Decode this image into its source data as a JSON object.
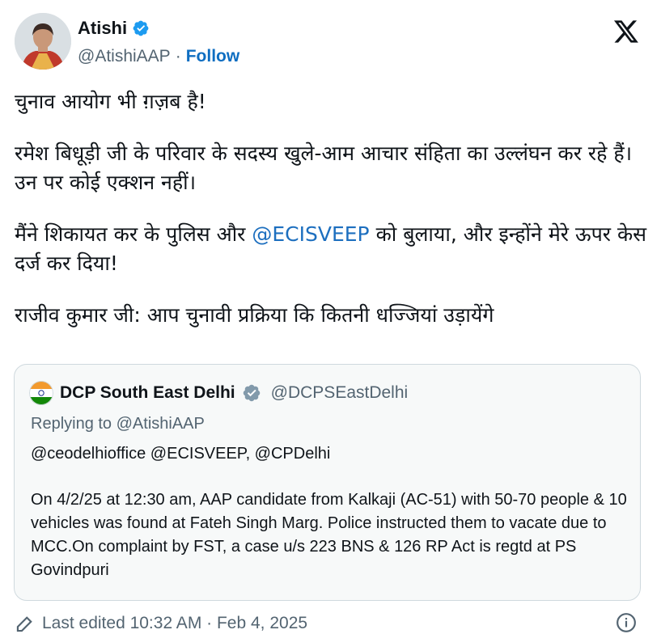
{
  "author": {
    "name": "Atishi",
    "handle": "@AtishiAAP",
    "follow_label": "Follow",
    "separator": "·"
  },
  "tweet": {
    "p1": "चुनाव आयोग भी ग़ज़ब है!",
    "p2": "रमेश बिधूड़ी जी के परिवार के सदस्य खुले-आम आचार संहिता का उल्लंघन कर रहे हैं। उन पर कोई एक्शन नहीं।",
    "p3_before": "मैंने शिकायत कर के पुलिस और ",
    "p3_mention": "@ECISVEEP",
    "p3_after": " को बुलाया, और इन्होंने मेरे ऊपर केस दर्ज कर दिया!",
    "p4": "राजीव कुमार जी: आप चुनावी प्रक्रिया कि कितनी धज्जियां उड़ायेंगे"
  },
  "quoted": {
    "name": "DCP South East Delhi",
    "handle": "@DCPSEastDelhi",
    "replying_to": "Replying to @AtishiAAP",
    "mentions": "@ceodelhioffice @ECISVEEP, @CPDelhi",
    "body": "On 4/2/25 at 12:30 am, AAP candidate from Kalkaji (AC-51) with 50-70 people & 10 vehicles was found at Fateh Singh Marg. Police instructed them to vacate due to MCC.On complaint by FST, a case u/s 223 BNS & 126 RP Act is regtd at PS Govindpuri"
  },
  "footer": {
    "edited": "Last edited 10:32 AM · Feb 4, 2025"
  },
  "icons": {
    "verified": "verified-badge-icon",
    "gov_badge": "government-badge-icon",
    "x": "x-logo-icon",
    "pencil": "pencil-icon",
    "info": "info-icon"
  },
  "colors": {
    "link": "#1d6fbf",
    "verified": "#1d9bf0",
    "gov_badge": "#829aab",
    "muted": "#536471"
  }
}
